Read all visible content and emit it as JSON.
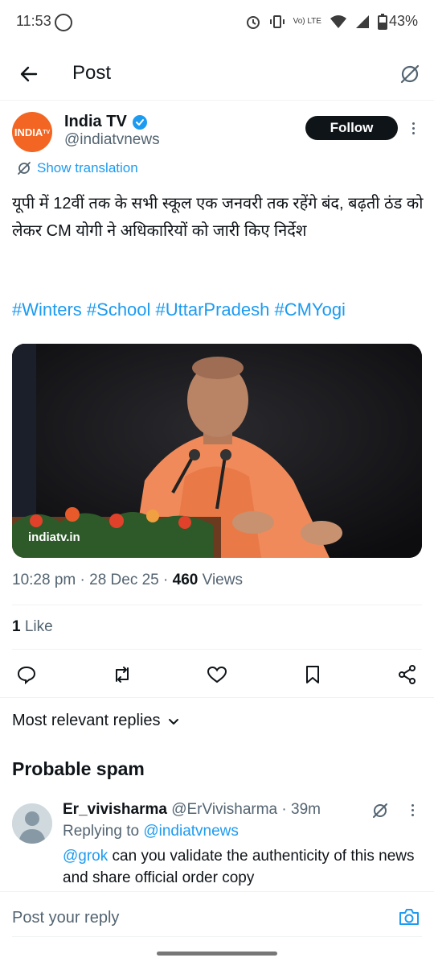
{
  "status": {
    "time": "11:53",
    "battery": "43%",
    "network_label": "Vo) LTE"
  },
  "header": {
    "title": "Post"
  },
  "author": {
    "logo_text": "INDIA",
    "logo_small": "TV",
    "name": "India TV",
    "handle": "@indiatvnews",
    "follow_label": "Follow"
  },
  "translation": {
    "label": "Show translation"
  },
  "tweet": {
    "text": "यूपी में 12वीं तक के सभी स्कूल एक जनवरी तक रहेंगे बंद, बढ़ती ठंड को लेकर CM योगी ने अधिकारियों को जारी किए निर्देश",
    "hashtags": "#Winters #School #UttarPradesh #CMYogi",
    "media_watermark": "indiatv.in",
    "time": "10:28 pm",
    "date": "28 Dec 25",
    "views_count": "460",
    "views_label": "Views",
    "likes_count": "1",
    "likes_label": "Like"
  },
  "replies": {
    "sort_label": "Most relevant replies",
    "section_title": "Probable spam",
    "items": [
      {
        "name": "Er_vivisharma",
        "handle": "@ErVivisharma",
        "time": "39m",
        "replying_prefix": "Replying to",
        "replying_to": "@indiatvnews",
        "mention": "@grok",
        "text": " can you validate the authenticity of this news and share official order copy"
      }
    ]
  },
  "compose": {
    "placeholder": "Post your reply"
  },
  "colors": {
    "accent": "#1d9bf0",
    "text": "#0f1419",
    "muted": "#536471",
    "brand_orange": "#f26522"
  },
  "icons": [
    "back-arrow-icon",
    "grok-icon",
    "verified-badge-icon",
    "more-vertical-icon",
    "translate-icon",
    "reply-icon",
    "repost-icon",
    "like-icon",
    "bookmark-icon",
    "share-icon",
    "chevron-down-icon",
    "camera-icon"
  ]
}
